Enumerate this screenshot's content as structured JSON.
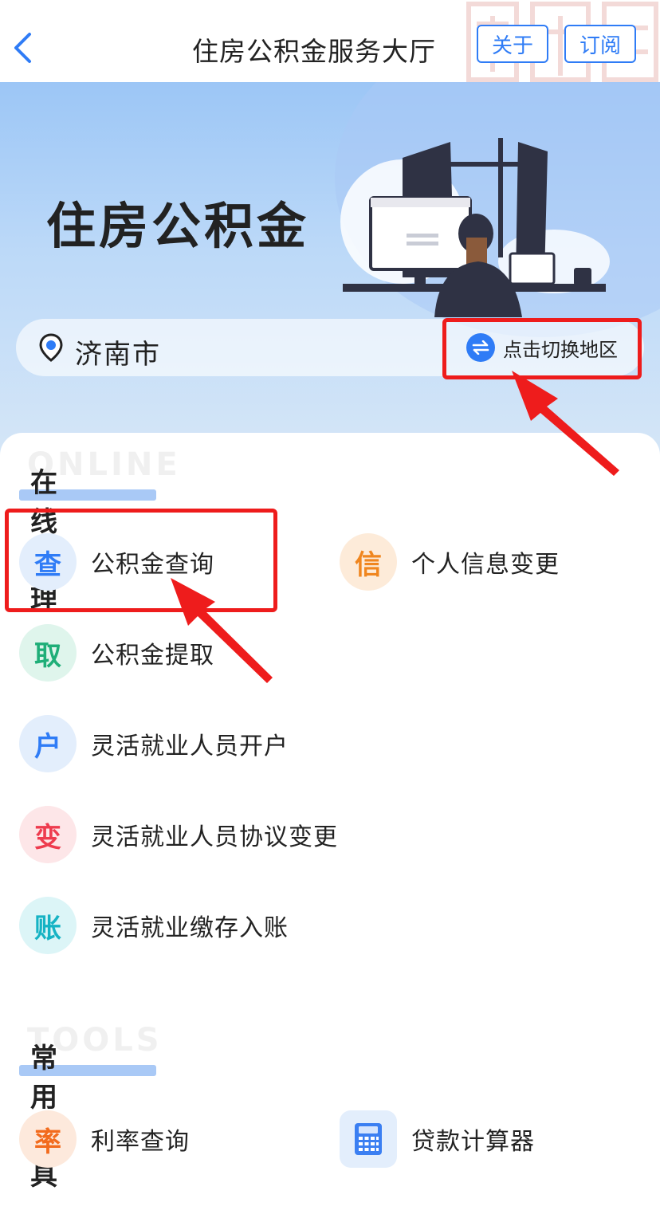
{
  "nav": {
    "title": "住房公积金服务大厅",
    "about_label": "关于",
    "subscribe_label": "订阅"
  },
  "hero": {
    "title": "住房公积金",
    "city": "济南市",
    "switch_label": "点击切换地区"
  },
  "online": {
    "ghost": "ONLINE",
    "title": "在线办理",
    "items": [
      {
        "badge": "查",
        "label": "公积金查询",
        "color": "#2f7cf6"
      },
      {
        "badge": "信",
        "label": "个人信息变更",
        "color": "#f0861f"
      },
      {
        "badge": "取",
        "label": "公积金提取",
        "color": "#1fae78"
      },
      {
        "badge": "户",
        "label": "灵活就业人员开户",
        "color": "#2f7cf6"
      },
      {
        "badge": "变",
        "label": "灵活就业人员协议变更",
        "color": "#ee3b4e"
      },
      {
        "badge": "账",
        "label": "灵活就业缴存入账",
        "color": "#16b3c4"
      }
    ]
  },
  "tools": {
    "ghost": "TOOLS",
    "title": "常用工具",
    "items": [
      {
        "badge": "率",
        "label": "利率查询",
        "color": "#f26b1d"
      },
      {
        "badge": "calculator-icon",
        "label": "贷款计算器",
        "color": "#2f7cf6"
      }
    ]
  },
  "colors": {
    "accent": "#2f7cf6",
    "annotation": "#ee1c1c"
  }
}
